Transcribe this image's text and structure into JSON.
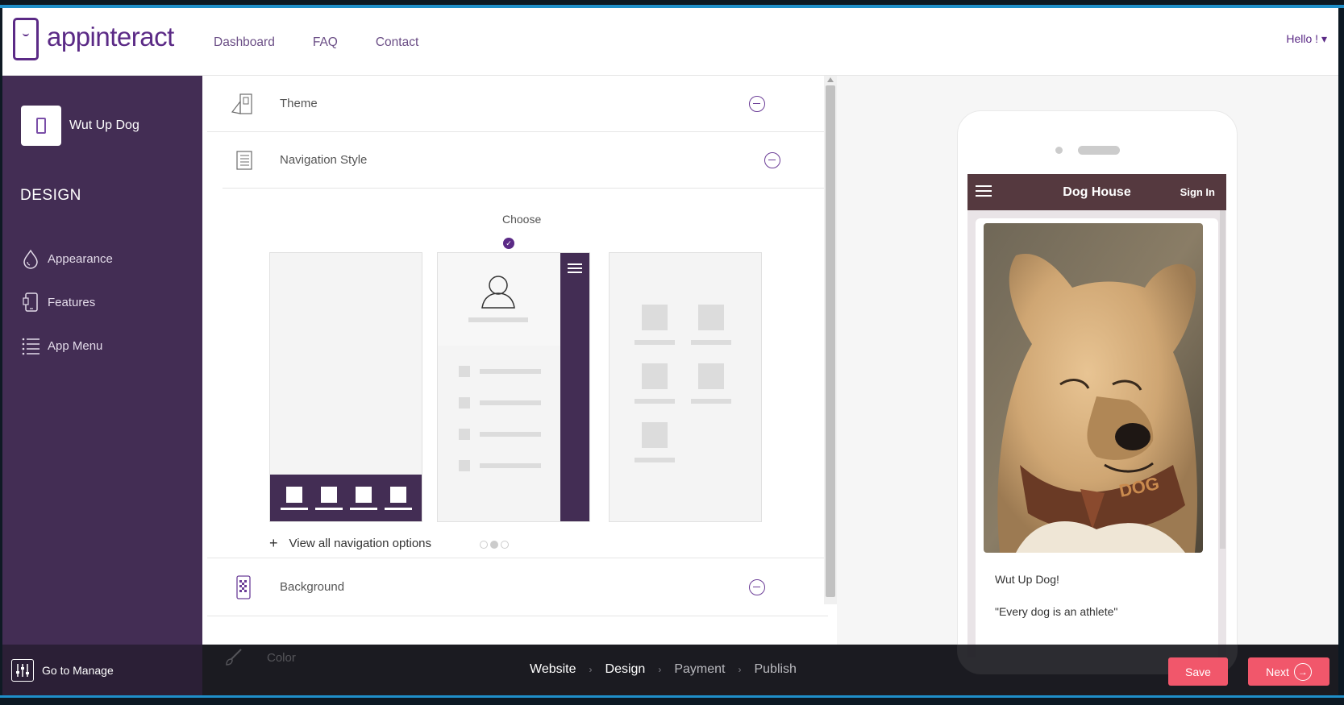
{
  "header": {
    "logo_text": "appinteract",
    "nav": [
      "Dashboard",
      "FAQ",
      "Contact"
    ],
    "greeting": "Hello ! ▾"
  },
  "sidebar": {
    "app_name": "Wut Up Dog",
    "section_title": "DESIGN",
    "items": [
      {
        "label": "Appearance",
        "icon": "droplet-icon"
      },
      {
        "label": "Features",
        "icon": "phone-icon"
      },
      {
        "label": "App Menu",
        "icon": "list-icon"
      }
    ],
    "manage_label": "Go to Manage"
  },
  "panel": {
    "sections": [
      {
        "label": "Theme",
        "icon": "theme-icon"
      },
      {
        "label": "Navigation Style",
        "icon": "navigation-icon"
      },
      {
        "label": "Background",
        "icon": "background-icon"
      },
      {
        "label": "Color",
        "icon": "brush-icon"
      }
    ],
    "choose_label": "Choose",
    "view_all_label": "View all navigation options",
    "selected_option": 2
  },
  "steps": [
    "Website",
    "Design",
    "Payment",
    "Publish"
  ],
  "buttons": {
    "save": "Save",
    "next": "Next"
  },
  "preview": {
    "app_title": "Dog House",
    "sign_in": "Sign In",
    "card_title": "Wut Up Dog!",
    "card_quote": "\"Every dog is an athlete\""
  },
  "colors": {
    "brand_purple": "#5b2a86",
    "sidebar_bg": "#432d54",
    "accent_red": "#f1576b",
    "app_header": "#55393f"
  }
}
